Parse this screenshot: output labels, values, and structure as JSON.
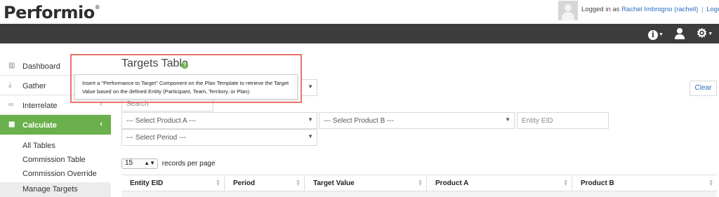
{
  "header": {
    "logo": "Performio",
    "logo_mark": "®",
    "logged_in_prefix": "Logged in as",
    "user_name": "Rachel Imbrogno (rachell)",
    "separator": "|",
    "logout": "Logout"
  },
  "toolbar": {
    "info_icon": "info-icon",
    "user_icon": "user-icon",
    "settings_icon": "gear-icon"
  },
  "sidebar": {
    "items": [
      {
        "label": "Dashboard",
        "icon": "bar-chart-icon"
      },
      {
        "label": "Gather",
        "icon": "download-icon"
      },
      {
        "label": "Interrelate",
        "icon": "link-icon"
      },
      {
        "label": "Calculate",
        "icon": "table-icon"
      }
    ],
    "subitems": [
      {
        "label": "All Tables"
      },
      {
        "label": "Commission Table"
      },
      {
        "label": "Commission Override"
      },
      {
        "label": "Manage Targets"
      }
    ],
    "active_color": "#6ab04c"
  },
  "main": {
    "title": "Targets Table",
    "tooltip": "Insert a \"Performance to Target\" Component on the Plan Template to retrieve the Target Value based on the defined Entity (Participant, Team, Territory, or Plan).",
    "clear_label": "Clear",
    "search_placeholder": "Search",
    "filters": {
      "product_a": "--- Select Product A ---",
      "product_b": "--- Select Product B ---",
      "entity_eid": "Entity EID",
      "period": "--- Select Period ---"
    },
    "records_per_page_value": "15",
    "records_per_page_label": "records per page",
    "columns": [
      "Entity EID",
      "Period",
      "Target Value",
      "Product A",
      "Product B"
    ]
  },
  "colors": {
    "header_dark": "#3c3c3c",
    "accent_green": "#6ab04c",
    "link_blue": "#2a6ebb",
    "highlight_outline": "#e8756a"
  }
}
